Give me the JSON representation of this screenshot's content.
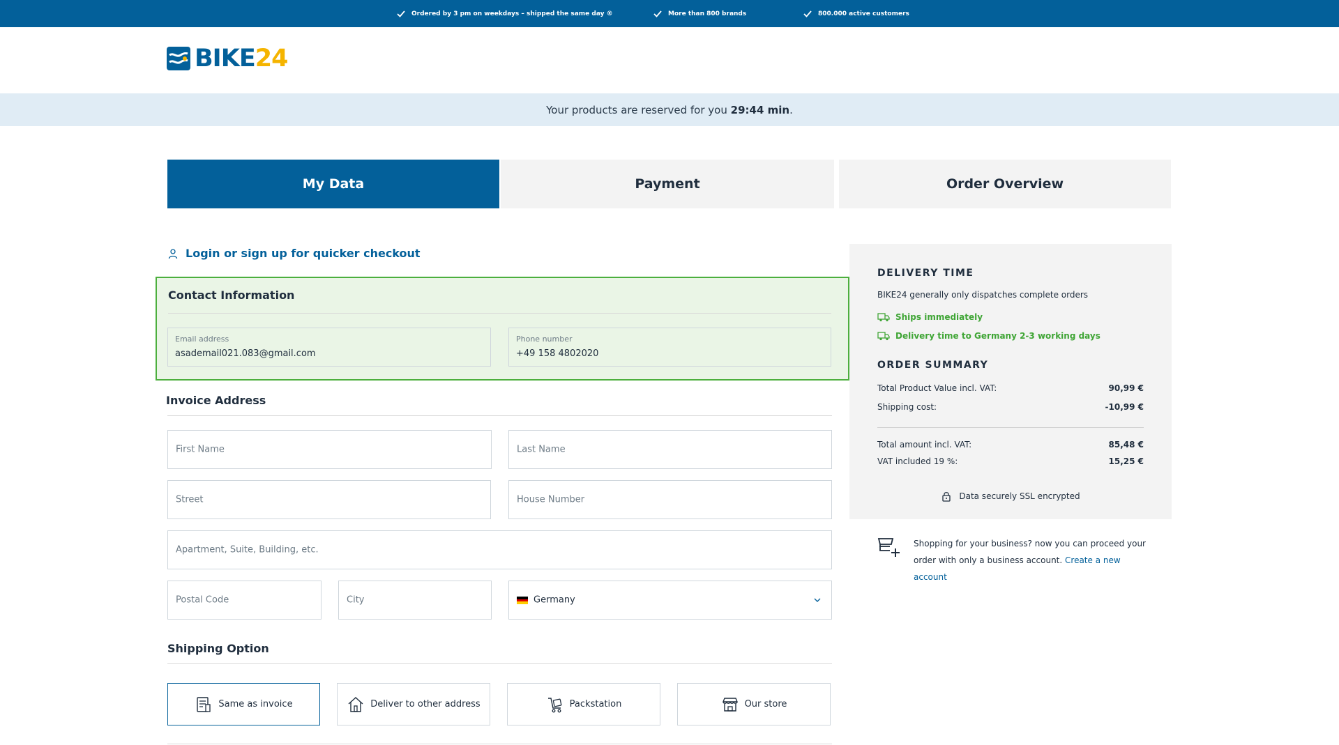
{
  "topbar": {
    "usps": [
      "Ordered by 3 pm on weekdays – shipped the same day ®",
      "More than 800 brands",
      "800.000 active customers"
    ]
  },
  "logo": {
    "part1": "BIKE",
    "part2": "24"
  },
  "reservation": {
    "prefix": "Your products are reserved for you",
    "time": "29:44 min",
    "suffix": "."
  },
  "steps": [
    {
      "label": "My Data",
      "active": true
    },
    {
      "label": "Payment",
      "active": false
    },
    {
      "label": "Order Overview",
      "active": false
    }
  ],
  "login_link": "Login or sign up for quicker checkout",
  "contact": {
    "title": "Contact Information",
    "email_label": "Email address",
    "email_value": "asademail021.083@gmail.com",
    "phone_label": "Phone number",
    "phone_value": "+49 158 4802020"
  },
  "invoice": {
    "title": "Invoice Address",
    "first_name_placeholder": "First Name",
    "last_name_placeholder": "Last Name",
    "street_placeholder": "Street",
    "house_number_placeholder": "House Number",
    "apartment_placeholder": "Apartment, Suite, Building, etc.",
    "postal_code_placeholder": "Postal Code",
    "city_placeholder": "City",
    "country_value": "Germany"
  },
  "shipping": {
    "title": "Shipping Option",
    "options": [
      {
        "label": "Same as invoice",
        "icon": "invoice-icon",
        "selected": true
      },
      {
        "label": "Deliver to other address",
        "icon": "home-icon",
        "selected": false
      },
      {
        "label": "Packstation",
        "icon": "cart-icon",
        "selected": false
      },
      {
        "label": "Our store",
        "icon": "store-icon",
        "selected": false
      }
    ]
  },
  "sidebar": {
    "delivery_heading": "DELIVERY TIME",
    "delivery_note": "BIKE24 generally only dispatches complete orders",
    "ships_immediately": "Ships immediately",
    "delivery_time": "Delivery time to Germany 2-3 working days",
    "summary_heading": "ORDER SUMMARY",
    "rows": [
      {
        "label": "Total Product Value incl. VAT:",
        "amount": "90,99 €"
      },
      {
        "label": "Shipping cost:",
        "amount": "-10,99 €"
      }
    ],
    "totals": [
      {
        "label": "Total amount incl. VAT:",
        "amount": "85,48 €"
      },
      {
        "label": "VAT included 19 %:",
        "amount": "15,25 €"
      }
    ],
    "ssl_text": "Data securely SSL encrypted"
  },
  "business": {
    "text": "Shopping for your business? now you can proceed your order with only a business account.",
    "link": "Create a new account"
  },
  "colors": {
    "brand_blue": "#03609a",
    "brand_yellow": "#f5b400",
    "success_green": "#3fa535",
    "contact_bg": "#eaf5e6"
  }
}
